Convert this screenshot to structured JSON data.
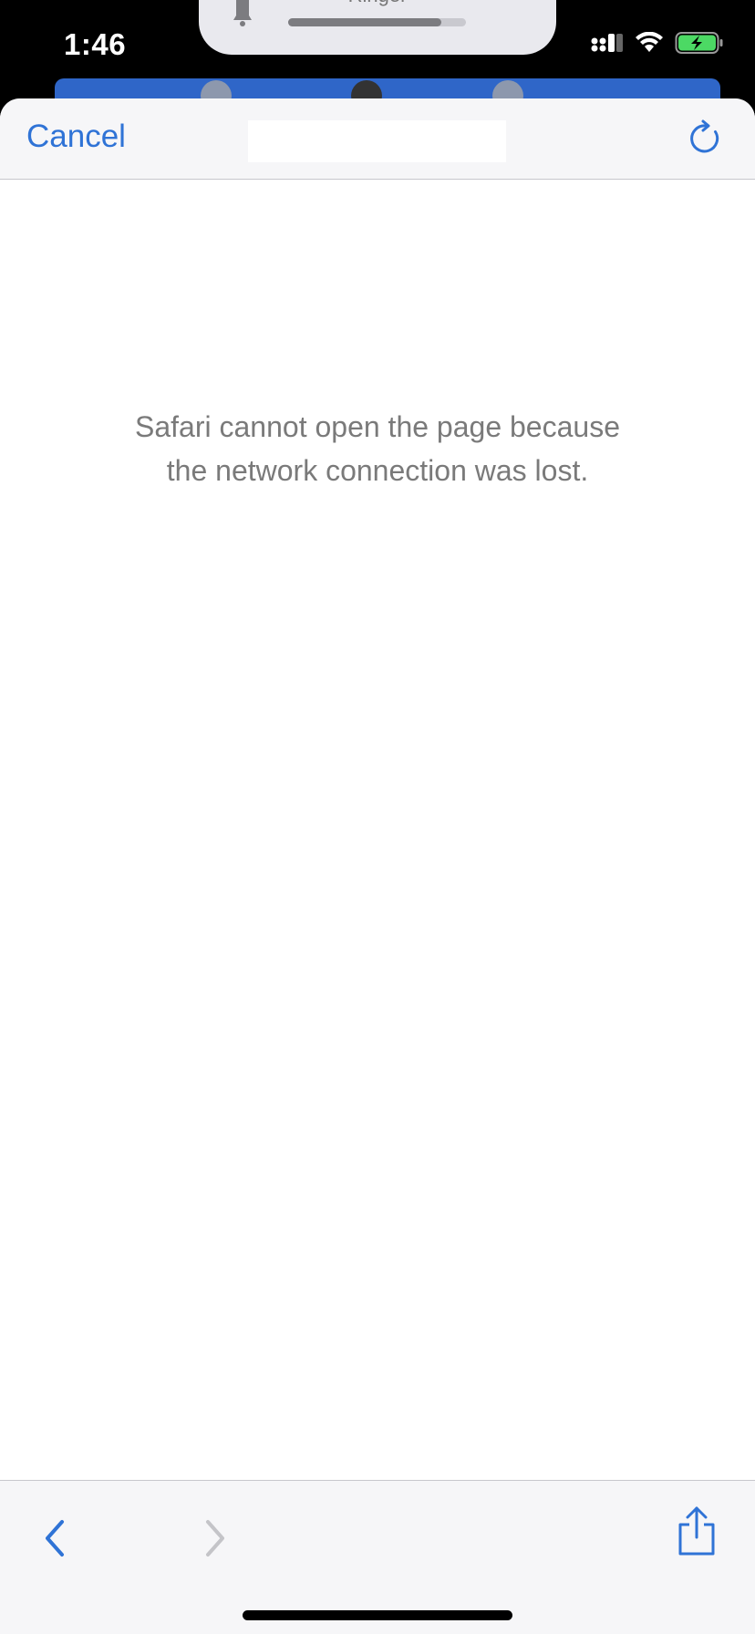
{
  "status_bar": {
    "time": "1:46"
  },
  "ringer_hud": {
    "label": "Ringer",
    "volume_fraction": 0.86
  },
  "nav": {
    "cancel_label": "Cancel",
    "url": ""
  },
  "error": {
    "line1": "Safari cannot open the page because",
    "line2": "the network connection was lost."
  },
  "toolbar": {
    "back_enabled": true,
    "forward_enabled": false
  },
  "colors": {
    "accent": "#2f73d6",
    "battery_charging": "#4cd964",
    "error_text": "#7a7a7a"
  },
  "icons": [
    "signal-icon",
    "wifi-icon",
    "battery-charging-icon",
    "bell-icon",
    "reload-icon",
    "back-chevron-icon",
    "forward-chevron-icon",
    "share-icon"
  ]
}
